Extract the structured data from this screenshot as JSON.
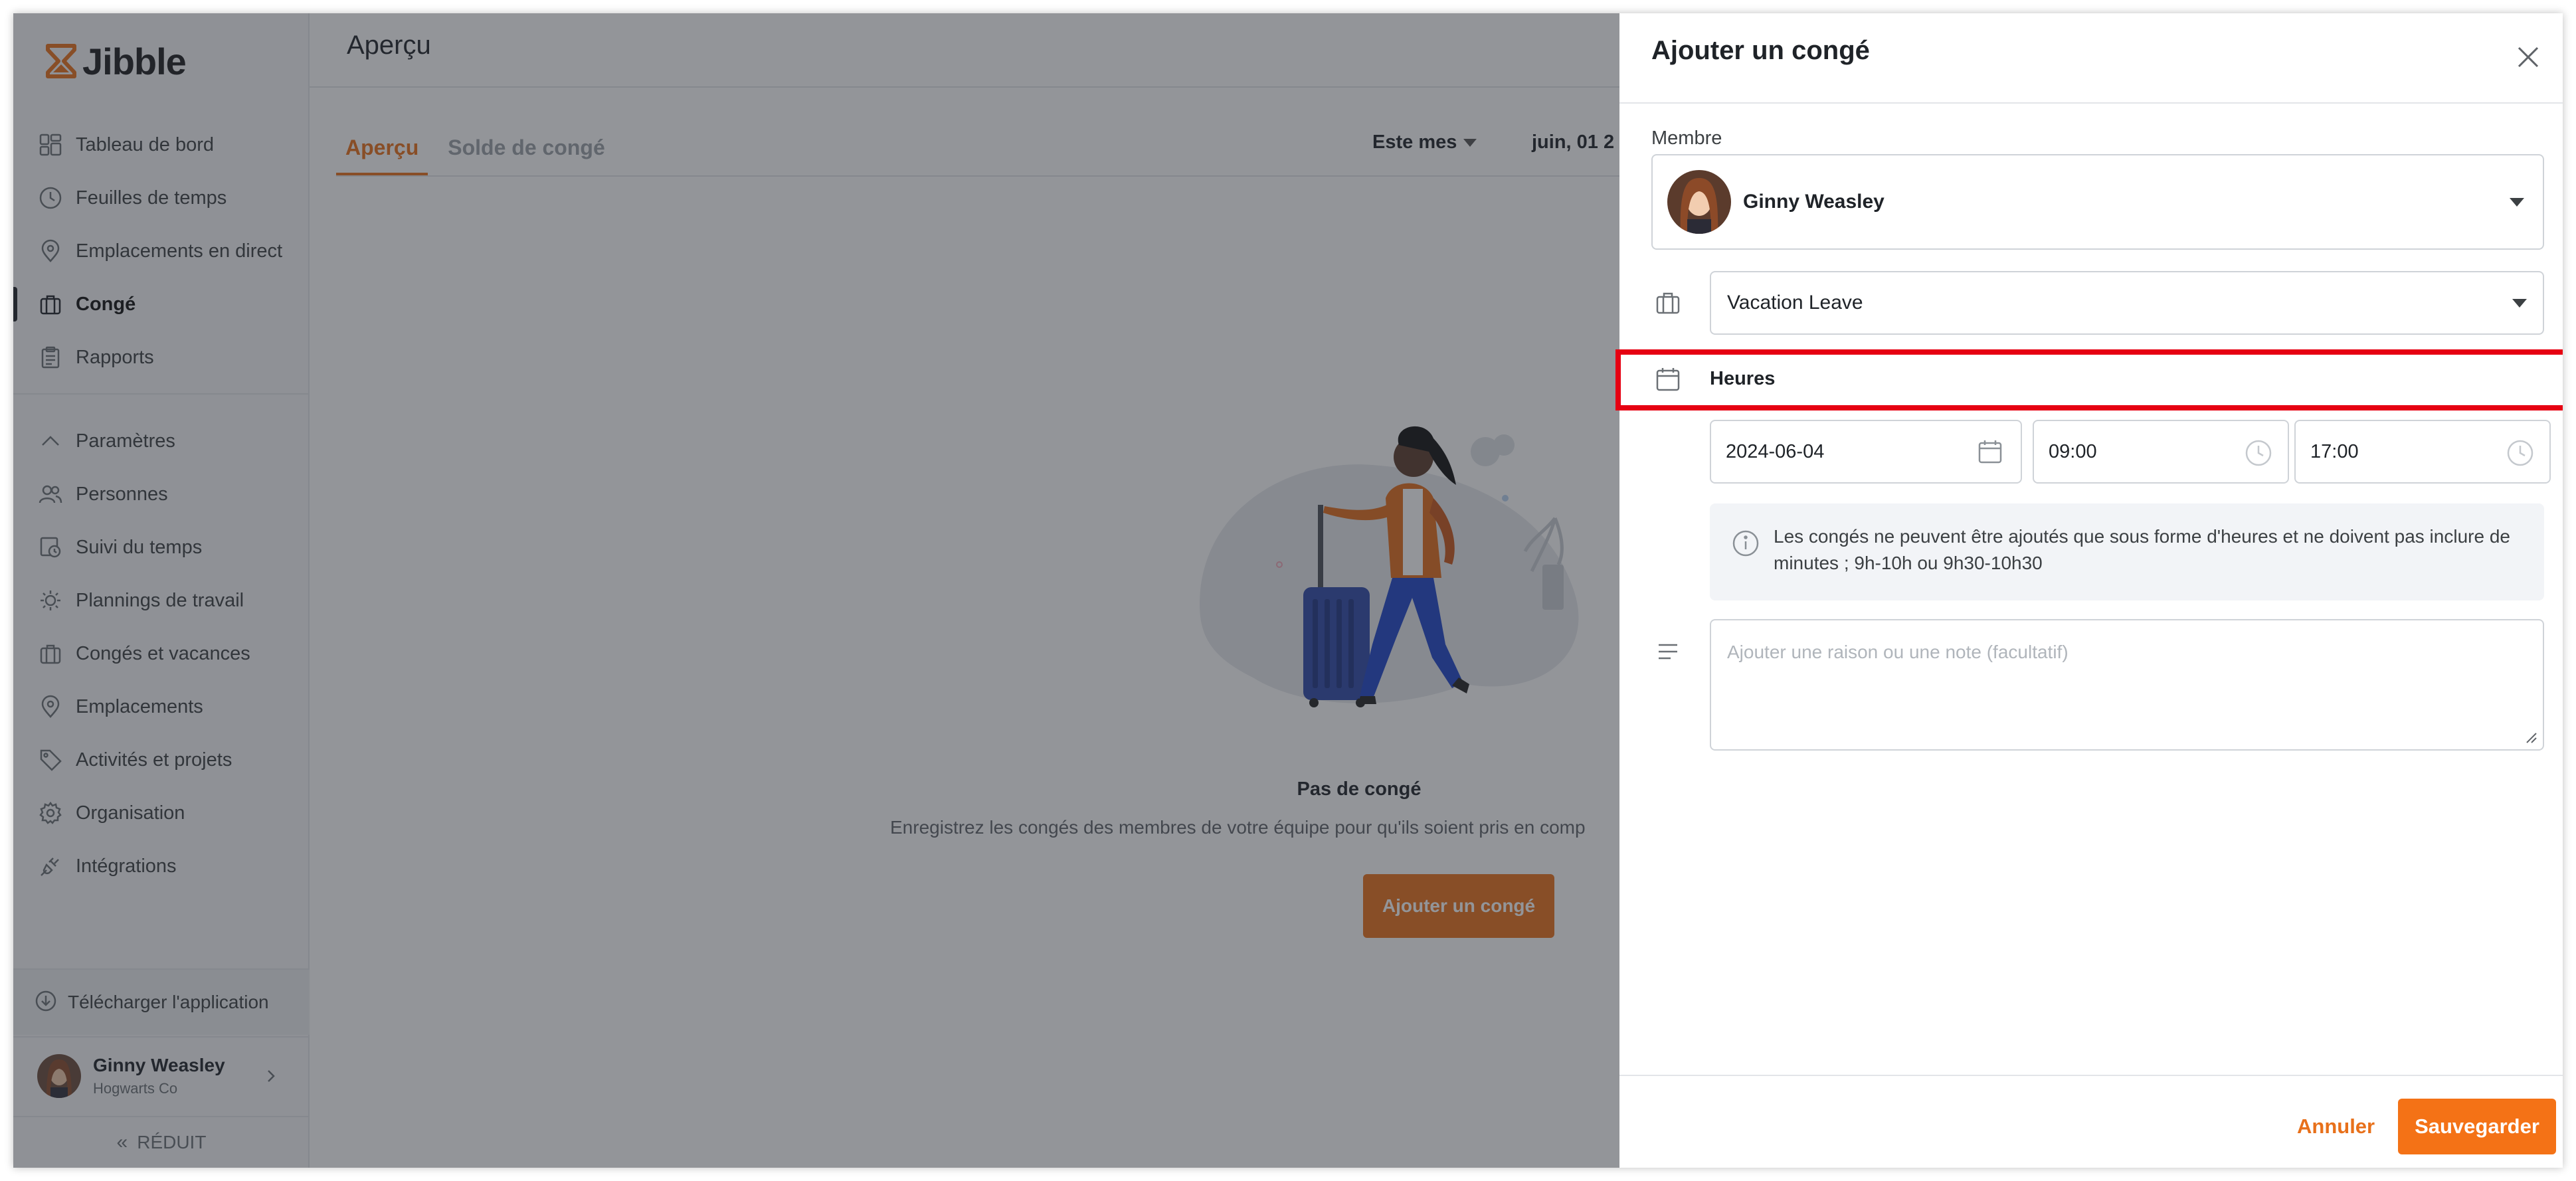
{
  "app": {
    "logo_text": "Jibble"
  },
  "sidebar": {
    "items_main": [
      {
        "label": "Tableau de bord",
        "icon": "dashboard-icon"
      },
      {
        "label": "Feuilles de temps",
        "icon": "clock-icon"
      },
      {
        "label": "Emplacements en direct",
        "icon": "location-pin-icon"
      },
      {
        "label": "Congé",
        "icon": "briefcase-icon",
        "active": true
      },
      {
        "label": "Rapports",
        "icon": "clipboard-icon"
      }
    ],
    "items_settings": [
      {
        "label": "Paramètres",
        "icon": "chevron-up-icon"
      },
      {
        "label": "Personnes",
        "icon": "people-icon"
      },
      {
        "label": "Suivi du temps",
        "icon": "time-tracking-icon"
      },
      {
        "label": "Plannings de travail",
        "icon": "schedule-icon"
      },
      {
        "label": "Congés et vacances",
        "icon": "briefcase-icon"
      },
      {
        "label": "Emplacements",
        "icon": "location-pin-icon"
      },
      {
        "label": "Activités et projets",
        "icon": "tag-icon"
      },
      {
        "label": "Organisation",
        "icon": "gear-icon"
      },
      {
        "label": "Intégrations",
        "icon": "plug-icon"
      }
    ],
    "download_label": "Télécharger l'application",
    "user": {
      "name": "Ginny Weasley",
      "company": "Hogwarts Co"
    },
    "collapse_label": "RÉDUIT"
  },
  "main": {
    "title": "Aperçu",
    "tabs": [
      {
        "label": "Aperçu",
        "active": true
      },
      {
        "label": "Solde de congé"
      }
    ],
    "filter_label": "Este mes",
    "date_range": "juin, 01 2",
    "empty": {
      "title": "Pas de congé",
      "subtitle": "Enregistrez les congés des membres de votre équipe pour qu'ils soient pris en comp",
      "button": "Ajouter un congé"
    }
  },
  "drawer": {
    "title": "Ajouter un congé",
    "member_label": "Membre",
    "member_name": "Ginny Weasley",
    "leave_type": "Vacation Leave",
    "hours_label": "Heures",
    "date_value": "2024-06-04",
    "start_time": "09:00",
    "end_time": "17:00",
    "info_text": "Les congés ne peuvent être ajoutés que sous forme d'heures et ne doivent pas inclure de minutes ; 9h-10h ou 9h30-10h30",
    "note_placeholder": "Ajouter une raison ou une note (facultatif)",
    "cancel_label": "Annuler",
    "save_label": "Sauvegarder"
  },
  "colors": {
    "accent": "#e8701a",
    "highlight": "#e60012"
  }
}
